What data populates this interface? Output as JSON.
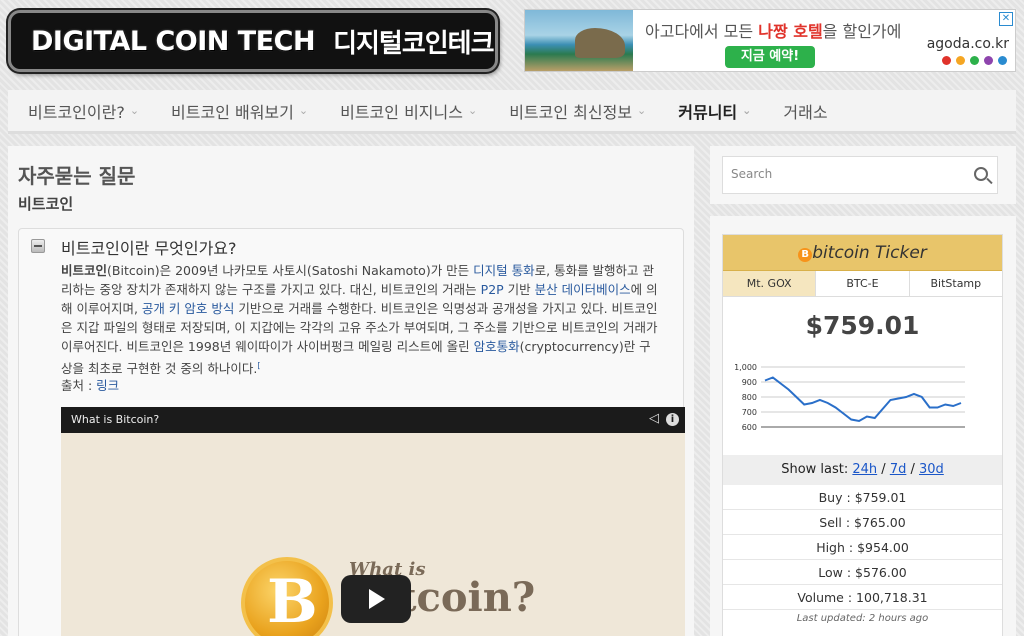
{
  "header": {
    "logo_en": "DIGITAL COIN TECH",
    "logo_ko": "디지털코인테크"
  },
  "ad": {
    "text_before": "아고다에서 모든 ",
    "text_highlight": "나짱 호텔",
    "text_after": "을 할인가에",
    "button": "지금 예약!",
    "domain": "agoda.co.kr",
    "close": "✕",
    "dot_colors": [
      "#e0332b",
      "#f5a623",
      "#2db14b",
      "#8e44ad",
      "#2a8bd0"
    ]
  },
  "nav": {
    "items": [
      {
        "label": "비트코인이란?",
        "chevron": true
      },
      {
        "label": "비트코인 배워보기",
        "chevron": true
      },
      {
        "label": "비트코인 비지니스",
        "chevron": true
      },
      {
        "label": "비트코인 최신정보",
        "chevron": true
      },
      {
        "label": "커뮤니티",
        "chevron": true
      },
      {
        "label": "거래소",
        "chevron": false
      }
    ]
  },
  "main": {
    "page_title": "자주묻는 질문",
    "section_title": "비트코인",
    "faq": {
      "question": "비트코인이란 무엇인가요?",
      "answer_parts": [
        {
          "t": "비트코인",
          "b": true
        },
        {
          "t": "(Bitcoin)은 2009년 나카모토 사토시(Satoshi Nakamoto)가 만든 "
        },
        {
          "t": "디지털 통화",
          "link": true
        },
        {
          "t": "로, 통화를 발행하고 관리하는 중앙 장치가 존재하지 않는 구조를 가지고 있다. 대신, 비트코인의 거래는 "
        },
        {
          "t": "P2P",
          "link": true
        },
        {
          "t": " 기반 "
        },
        {
          "t": "분산 데이터베이스",
          "link": true
        },
        {
          "t": "에 의해 이루어지며, "
        },
        {
          "t": "공개 키 암호 방식",
          "link": true
        },
        {
          "t": " 기반으로 거래를 수행한다. 비트코인은 익명성과 공개성을 가지고 있다. 비트코인은 지갑 파일의 형태로 저장되며, 이 지갑에는 각각의 고유 주소가 부여되며, 그 주소를 기반으로 비트코인의 거래가 이루어진다. 비트코인은 1998년 웨이따이가 사이버펑크 메일링 리스트에 올린 "
        },
        {
          "t": "암호통화",
          "link": true
        },
        {
          "t": "(cryptocurrency)란 구상을 최초로 구현한 것 중의 하나이다."
        },
        {
          "t": "[",
          "sup": true
        }
      ],
      "source_label": "출처 : ",
      "source_link": "링크"
    },
    "video": {
      "title": "What is Bitcoin?",
      "overlay_line1": "What is",
      "overlay_line2": "Bitcoin?",
      "coin_symbol": "B"
    }
  },
  "sidebar": {
    "search_placeholder": "Search",
    "ticker": {
      "title_prefix": "bitcoin Ticker",
      "tabs": [
        "Mt. GOX",
        "BTC-E",
        "BitStamp"
      ],
      "active_tab": 0,
      "price": "$759.01",
      "show_last_label": "Show last: ",
      "ranges": [
        "24h",
        "7d",
        "30d"
      ],
      "stats": [
        {
          "label": "Buy",
          "value": "$759.01"
        },
        {
          "label": "Sell",
          "value": "$765.00"
        },
        {
          "label": "High",
          "value": "$954.00"
        },
        {
          "label": "Low",
          "value": "$576.00"
        },
        {
          "label": "Volume",
          "value": "100,718.31"
        }
      ],
      "last_updated": "Last updated: 2 hours ago"
    }
  },
  "chart_data": {
    "type": "line",
    "ylim": [
      600,
      1000
    ],
    "yticks": [
      "1,000",
      "900",
      "800",
      "700",
      "600"
    ],
    "ytick_values": [
      1000,
      900,
      800,
      700,
      600
    ],
    "values": [
      910,
      930,
      890,
      850,
      800,
      750,
      760,
      780,
      760,
      730,
      690,
      650,
      640,
      670,
      660,
      720,
      780,
      790,
      800,
      820,
      800,
      730,
      730,
      750,
      740,
      760
    ],
    "color": "#2a6fc9"
  }
}
